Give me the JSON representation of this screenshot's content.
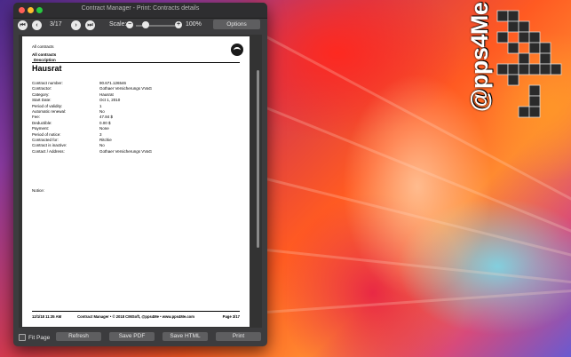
{
  "window": {
    "title": "Contract Manager - Print: Contracts details"
  },
  "toolbar": {
    "first_icon": "first-page-icon",
    "prev_icon": "previous-page-icon",
    "page_indicator": "3/17",
    "next_icon": "next-page-icon",
    "last_icon": "last-page-icon",
    "scale_label": "Scale:",
    "scale_value": 0.2,
    "zoom": "100%",
    "options_label": "Options"
  },
  "page": {
    "header_line1": "All contracts",
    "header_line2": "All contracts",
    "header_line3": "Description",
    "title": "Hausrat",
    "fields": [
      {
        "label": "Contract number:",
        "value": "90.671.126546"
      },
      {
        "label": "Contractor:",
        "value": "Gothaer Versicherungs VVaG"
      },
      {
        "label": "Category:",
        "value": "Hausrat"
      },
      {
        "label": "Start Date:",
        "value": "Oct 1, 2010"
      },
      {
        "label": "Period of validity:",
        "value": "1"
      },
      {
        "label": "Automatic renewal:",
        "value": "No"
      },
      {
        "label": "Fee:",
        "value": "47.84 $"
      },
      {
        "label": "Deductible:",
        "value": "0.00 $"
      },
      {
        "label": "Payment:",
        "value": "None"
      },
      {
        "label": "Period of notice:",
        "value": "3"
      },
      {
        "label": "Contracted for:",
        "value": "Ritchie"
      },
      {
        "label": "Contract is inactive:",
        "value": "No"
      },
      {
        "label": "Contact / Address:",
        "value": "Gothaer Versicherungs VVaG"
      }
    ],
    "notice_label": "Notice:",
    "footer_left": "12/1/18 11:35 AM",
    "footer_center": "Contract Manager  •  © 2018 CIMSoft, @pps4Me  •  www.pps4Me.com",
    "footer_right": "Page 3/17"
  },
  "bottombar": {
    "fit_page_label": "Fit Page",
    "refresh_label": "Refresh",
    "save_pdf_label": "Save PDF",
    "save_html_label": "Save HTML",
    "print_label": "Print"
  },
  "desktop": {
    "logo_text": "@pps4Me"
  }
}
